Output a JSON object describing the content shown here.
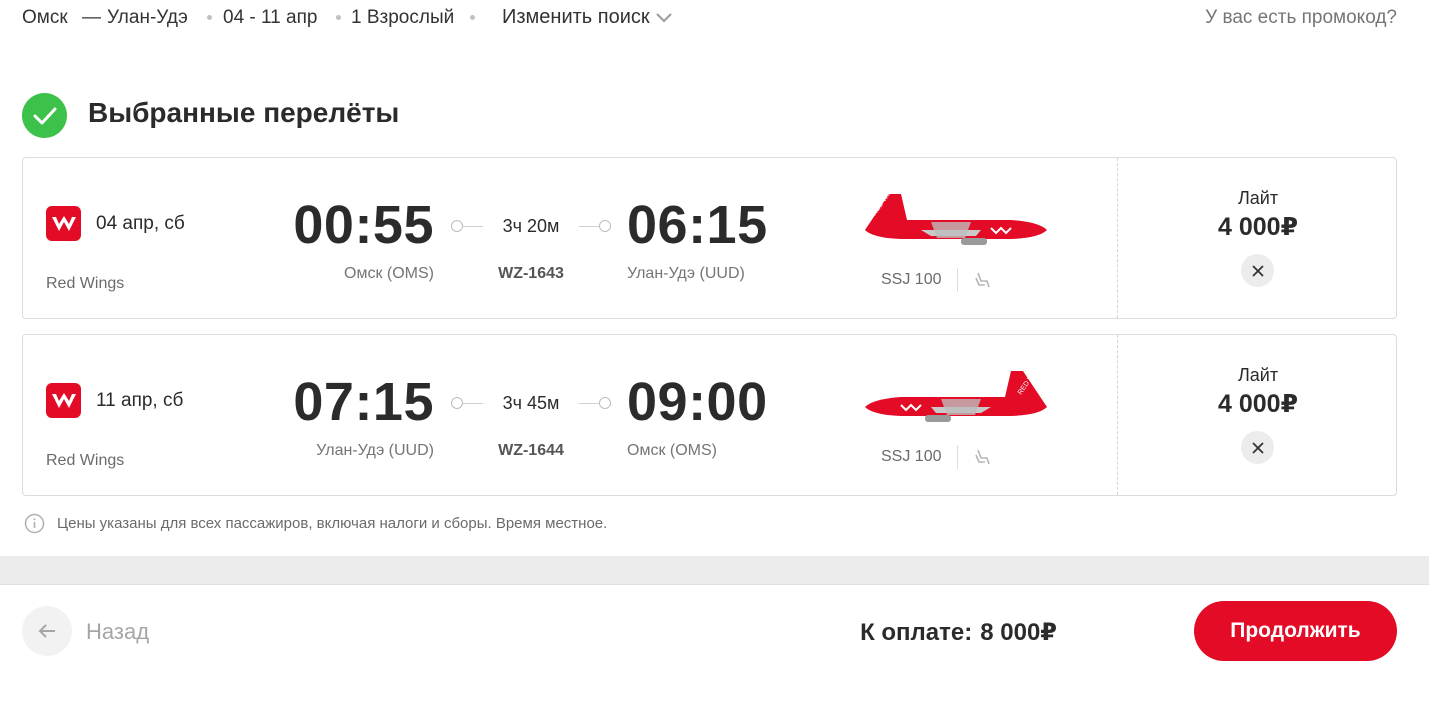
{
  "header": {
    "origin": "Омск",
    "dash": "—",
    "destination": "Улан-Удэ",
    "dates": "04 - 11 апр",
    "passengers": "1 Взрослый",
    "change_search": "Изменить поиск",
    "promo": "У вас есть промокод?"
  },
  "section": {
    "title": "Выбранные перелёты"
  },
  "flights": [
    {
      "date": "04 апр, сб",
      "airline": "Red Wings",
      "dep_time": "00:55",
      "dep_city": "Омск (OMS)",
      "duration": "3ч 20м",
      "flight_number": "WZ-1643",
      "arr_time": "06:15",
      "arr_city": "Улан-Удэ (UUD)",
      "aircraft": "SSJ 100",
      "tariff": "Лайт",
      "price": "4 000₽"
    },
    {
      "date": "11 апр, сб",
      "airline": "Red Wings",
      "dep_time": "07:15",
      "dep_city": "Улан-Удэ (UUD)",
      "duration": "3ч 45м",
      "flight_number": "WZ-1644",
      "arr_time": "09:00",
      "arr_city": "Омск (OMS)",
      "aircraft": "SSJ 100",
      "tariff": "Лайт",
      "price": "4 000₽"
    }
  ],
  "note": "Цены указаны для всех пассажиров, включая налоги и сборы. Время местное.",
  "footer": {
    "back_label": "Назад",
    "total_label": "К оплате:",
    "total_amount": "8 000₽",
    "continue_label": "Продолжить"
  },
  "icons": {
    "check": "check-icon",
    "chevron": "chevron-down-icon",
    "close": "close-icon",
    "info": "info-icon",
    "back": "arrow-left-icon",
    "seat": "seat-icon"
  },
  "colors": {
    "brand_red": "#e30b25",
    "success_green": "#3cc14b"
  }
}
